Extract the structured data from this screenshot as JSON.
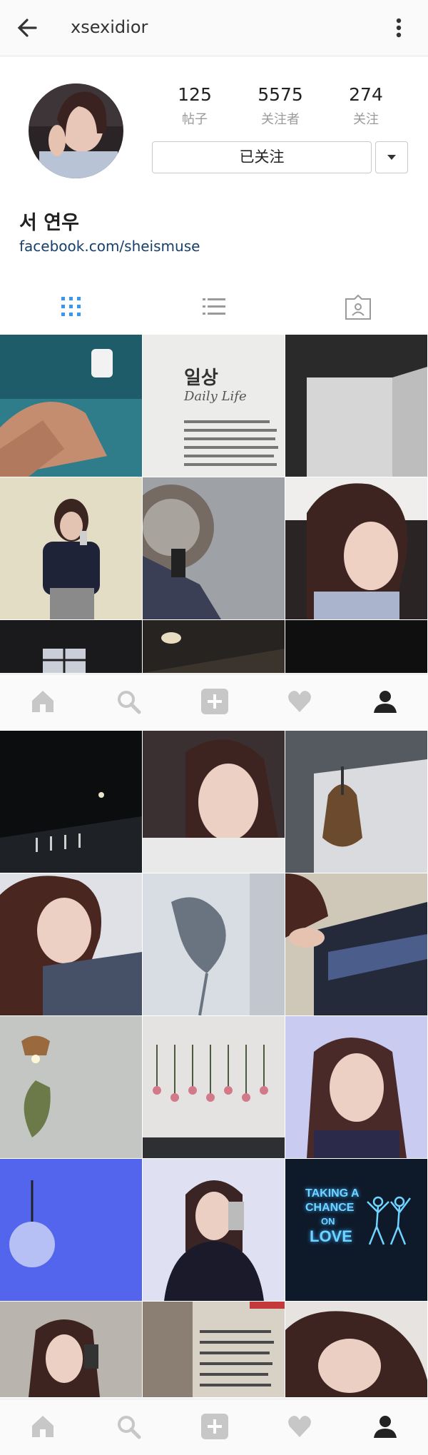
{
  "header": {
    "username": "xsexidior"
  },
  "profile": {
    "stats": [
      {
        "value": "125",
        "label": "帖子"
      },
      {
        "value": "5575",
        "label": "关注者"
      },
      {
        "value": "274",
        "label": "关注"
      }
    ],
    "follow_button": "已关注",
    "display_name": "서 연우",
    "link": "facebook.com/sheismuse"
  },
  "tabs": [
    {
      "icon": "grid-icon",
      "active": true
    },
    {
      "icon": "list-icon",
      "active": false
    },
    {
      "icon": "tagged-icon",
      "active": false
    }
  ],
  "tile_text": {
    "daily_ko": "일상",
    "daily_en": "Daily Life",
    "neon_1": "TAKING A",
    "neon_2": "CHANCE",
    "neon_3": "ON",
    "neon_4": "LOVE"
  },
  "bottom_nav": [
    "home-icon",
    "search-icon",
    "add-icon",
    "heart-icon",
    "profile-icon"
  ],
  "colors": {
    "accent": "#3897f0",
    "link": "#16406b",
    "muted": "#9a9a9a"
  }
}
